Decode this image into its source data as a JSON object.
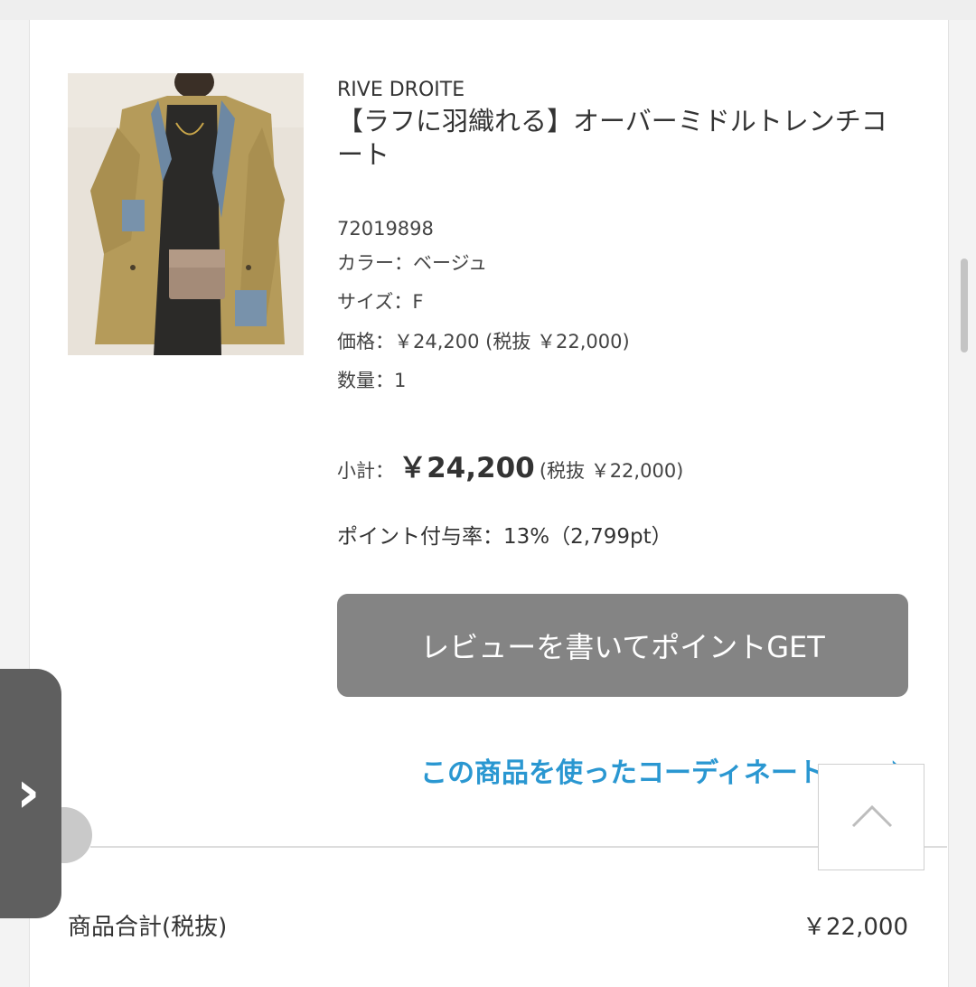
{
  "product": {
    "brand": "RIVE DROITE",
    "name": "【ラフに羽織れる】オーバーミドルトレンチコート",
    "code": "72019898",
    "color": "カラー：ベージュ",
    "size": "サイズ：F",
    "price": "価格：￥24,200 (税抜 ￥22,000)",
    "quantity": "数量：1"
  },
  "subtotal": {
    "label": "小計：",
    "amount": "￥24,200",
    "tax_excluded": "(税抜 ￥22,000)"
  },
  "points": "ポイント付与率：13%（2,799pt）",
  "review_button": "レビューを書いてポイントGET",
  "coordinate_link": "この商品を使ったコーディネート",
  "coordinate_link_chevron": "›",
  "summary": {
    "label": "商品合計(税抜)",
    "value": "￥22,000"
  },
  "side_tab": {
    "icon": "chevron-right-icon",
    "glyph": "›"
  },
  "colors": {
    "link": "#2a97d1",
    "button": "#848484"
  }
}
